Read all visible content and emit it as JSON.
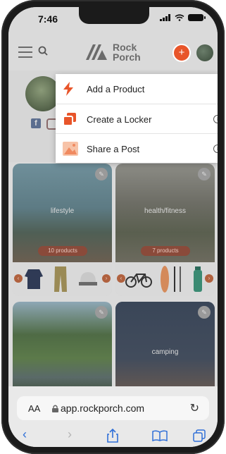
{
  "status": {
    "time": "7:46"
  },
  "brand": {
    "line1": "Rock",
    "line2": "Porch"
  },
  "header": {
    "plus_label": "+"
  },
  "social": {
    "facebook_glyph": "f"
  },
  "menu": {
    "items": [
      {
        "label": "Add a Product",
        "icon": "lightning-icon"
      },
      {
        "label": "Create a Locker",
        "icon": "locker-icon",
        "info": "i"
      },
      {
        "label": "Share a Post",
        "icon": "image-icon",
        "info": "i"
      }
    ]
  },
  "lockers": [
    {
      "title": "lifestyle",
      "count": "10 products"
    },
    {
      "title": "health/fitness",
      "count": "7 products"
    },
    {
      "title": ""
    },
    {
      "title": "camping"
    }
  ],
  "browser": {
    "aa": "AA",
    "url": "app.rockporch.com"
  },
  "colors": {
    "accent": "#e8552a",
    "link": "#2f6fd8"
  }
}
